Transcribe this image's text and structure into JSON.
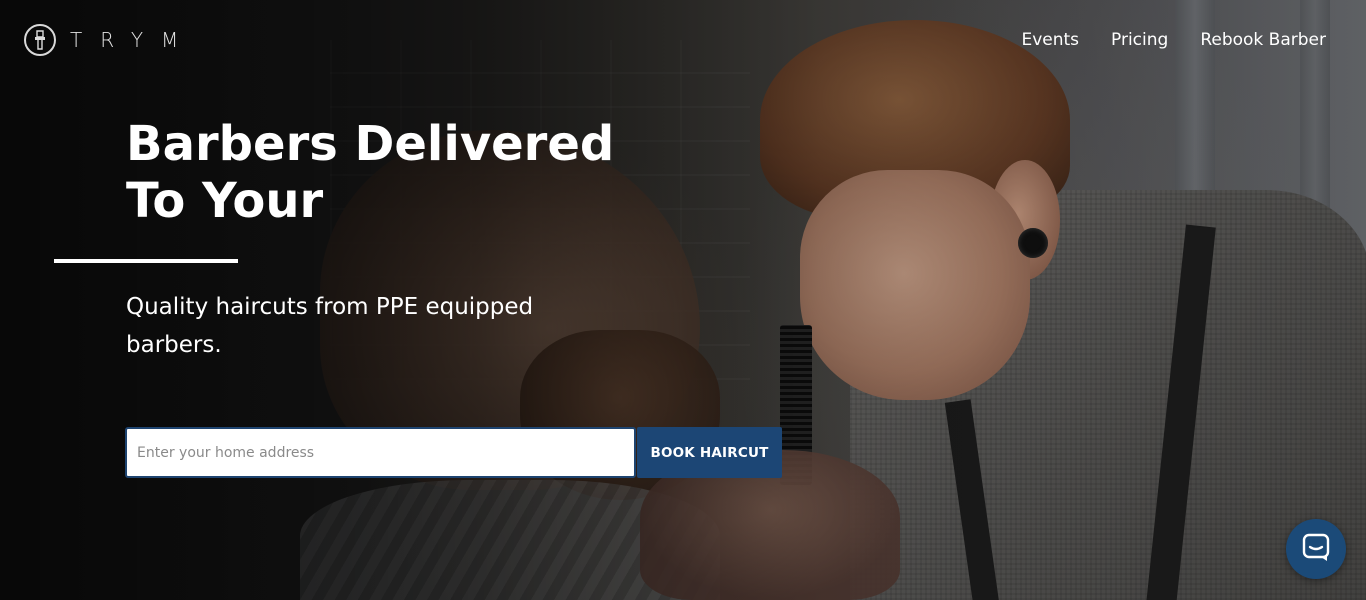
{
  "brand": {
    "name": "TRYM",
    "logo_icon": "razor-badge-icon"
  },
  "nav": {
    "items": [
      {
        "label": "Events"
      },
      {
        "label": "Pricing"
      },
      {
        "label": "Rebook Barber"
      }
    ]
  },
  "hero": {
    "headline": "Barbers Delivered To Your",
    "subheadline": "Quality haircuts from PPE equipped barbers."
  },
  "booking_form": {
    "address_placeholder": "Enter your home address",
    "address_value": "",
    "submit_label": "BOOK HAIRCUT"
  },
  "chat": {
    "icon": "chat-bubble-icon"
  },
  "colors": {
    "accent": "#1c4675",
    "input_border": "#1e4470",
    "text": "#ffffff"
  }
}
